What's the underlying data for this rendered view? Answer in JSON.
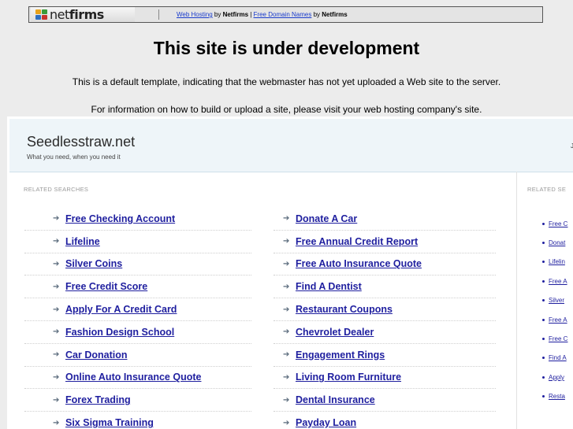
{
  "netfirms_bar": {
    "logo_text_net": "net",
    "logo_text_firms": "firms",
    "link1": "Web Hosting",
    "by1": " by ",
    "brand1": "Netfirms",
    "sep": " | ",
    "link2": "Free Domain Names",
    "by2": " by ",
    "brand2": "Netfirms"
  },
  "heading": "This site is under development",
  "paragraph1": "This is a default template, indicating that the webmaster has not yet uploaded a Web site to the server.",
  "paragraph2": "For information on how to build or upload a site, please visit your web hosting company's site.",
  "parked": {
    "domain": "Seedlesstraw.net",
    "tagline": "What you need, when you need it",
    "header_right_partial": "J",
    "related_label": "RELATED SEARCHES",
    "related_label_right": "RELATED SE",
    "column1": [
      "Free Checking Account",
      "Lifeline",
      "Silver Coins",
      "Free Credit Score",
      "Apply For A Credit Card",
      "Fashion Design School",
      "Car Donation",
      "Online Auto Insurance Quote",
      "Forex Trading",
      "Six Sigma Training"
    ],
    "column2": [
      "Donate A Car",
      "Free Annual Credit Report",
      "Free Auto Insurance Quote",
      "Find A Dentist",
      "Restaurant Coupons",
      "Chevrolet Dealer",
      "Engagement Rings",
      "Living Room Furniture",
      "Dental Insurance",
      "Payday Loan"
    ],
    "right_column_partial": [
      "Free C",
      "Donat",
      "Lifelin",
      "Free A",
      "Silver",
      "Free A",
      "Free C",
      "Find A",
      "Apply",
      "Resta"
    ]
  }
}
